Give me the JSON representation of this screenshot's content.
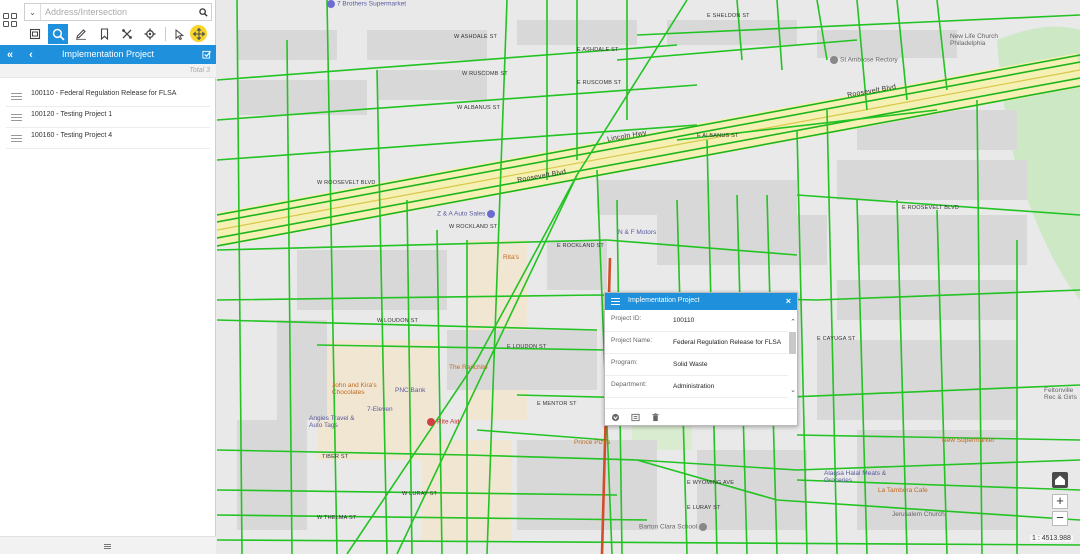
{
  "search": {
    "placeholder": "Address/Intersection"
  },
  "panel": {
    "title": "Implementation Project",
    "total": "Total 3",
    "projects": [
      {
        "label": "100110 - Federal Regulation Release for FLSA"
      },
      {
        "label": "100120 - Testing  Project 1"
      },
      {
        "label": "100160 - Testing Project 4"
      }
    ]
  },
  "popup": {
    "title": "Implementation Project",
    "rows": [
      {
        "label": "Project ID:",
        "value": "100110"
      },
      {
        "label": "Project Name:",
        "value": "Federal Regulation Release for FLSA"
      },
      {
        "label": "Program:",
        "value": "Solid Waste"
      },
      {
        "label": "Department:",
        "value": "Administration"
      }
    ]
  },
  "map": {
    "streets": [
      {
        "text": "W ASHDALE ST"
      },
      {
        "text": "E ASHDALE ST"
      },
      {
        "text": "W RUSCOMB ST"
      },
      {
        "text": "E RUSCOMB ST"
      },
      {
        "text": "E SHELDON ST"
      },
      {
        "text": "W ALBANUS ST"
      },
      {
        "text": "E ALBANUS ST"
      },
      {
        "text": "W ROOSEVELT BLVD"
      },
      {
        "text": "E ROOSEVELT BLVD"
      },
      {
        "text": "W ROCKLAND ST"
      },
      {
        "text": "E ROCKLAND ST"
      },
      {
        "text": "W LOUDON ST"
      },
      {
        "text": "E LOUDON ST"
      },
      {
        "text": "E MENTOR ST"
      },
      {
        "text": "W LURAY ST"
      },
      {
        "text": "E WYOMING AVE"
      },
      {
        "text": "E CAYUGA ST"
      },
      {
        "text": "E LURAY ST"
      },
      {
        "text": "TIBER ST"
      },
      {
        "text": "W THELMA ST"
      }
    ],
    "roads": [
      {
        "text": "Roosevelt Blvd"
      },
      {
        "text": "Lincoln Hwy"
      },
      {
        "text": "Roosevelt Blvd"
      }
    ],
    "pois": [
      {
        "text": "7 Brothers Supermarket"
      },
      {
        "text": "New Life Church Philadelphia"
      },
      {
        "text": "St Ambrose Rectory"
      },
      {
        "text": "Z & A Auto Sales"
      },
      {
        "text": "N & F Motors"
      },
      {
        "text": "Rita's"
      },
      {
        "text": "The Ranchito"
      },
      {
        "text": "John and Kira's Chocolates"
      },
      {
        "text": "PNC Bank"
      },
      {
        "text": "7-Eleven"
      },
      {
        "text": "Angies Travel & Auto Tags"
      },
      {
        "text": "Rite Aid"
      },
      {
        "text": "Prince Pizza"
      },
      {
        "text": "Barton Clara School"
      },
      {
        "text": "Alaqsa Halal Meats & Groceries"
      },
      {
        "text": "La Tambora Cafe"
      },
      {
        "text": "Jerusalem Church"
      },
      {
        "text": "New Supermarket"
      },
      {
        "text": "Feltonville Rec & Girls"
      }
    ],
    "scale": "1 : 4513.988"
  }
}
